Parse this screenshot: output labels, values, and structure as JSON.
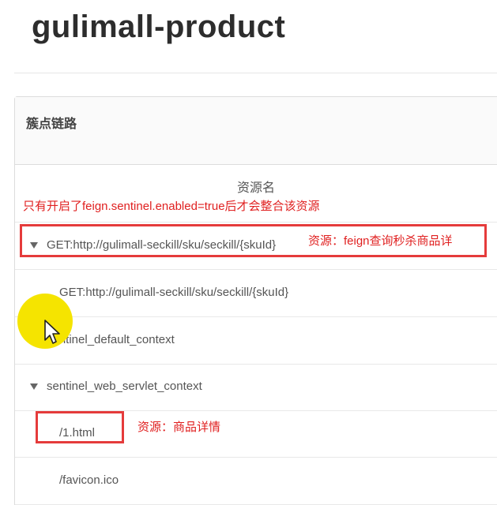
{
  "app": {
    "title": "gulimall-product"
  },
  "panel": {
    "heading": "簇点链路"
  },
  "table": {
    "column_header": "资源名",
    "annotation": "只有开启了feign.sentinel.enabled=true后才会整合该资源"
  },
  "rows": [
    {
      "text": "GET:http://gulimall-seckill/sku/seckill/{skuId}",
      "expanded": true
    },
    {
      "text": "GET:http://gulimall-seckill/sku/seckill/{skuId}"
    },
    {
      "text": "sentinel_default_context"
    },
    {
      "text": "sentinel_web_servlet_context",
      "expanded": true
    },
    {
      "text": "/1.html"
    },
    {
      "text": "/favicon.ico"
    }
  ],
  "annotations": {
    "feign_resource": "资源：feign查询秒杀商品详",
    "page_resource": "资源：商品详情"
  },
  "colors": {
    "annotation_red": "#e02020",
    "box_red": "#e53b3b",
    "cursor_highlight": "#f5e400"
  },
  "icons": [
    "caret-down-icon",
    "mouse-cursor-icon"
  ]
}
